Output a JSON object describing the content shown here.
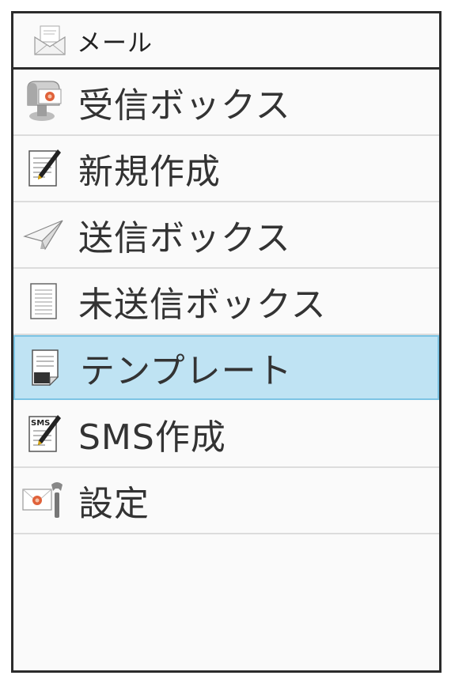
{
  "header": {
    "title": "メール",
    "icon": "mail-open-icon"
  },
  "menu": {
    "items": [
      {
        "label": "受信ボックス",
        "icon": "inbox-mailbox-icon"
      },
      {
        "label": "新規作成",
        "icon": "compose-pen-icon"
      },
      {
        "label": "送信ボックス",
        "icon": "paper-plane-icon"
      },
      {
        "label": "未送信ボックス",
        "icon": "document-icon"
      },
      {
        "label": "テンプレート",
        "icon": "template-note-icon",
        "selected": true
      },
      {
        "label": "SMS作成",
        "icon": "sms-compose-icon",
        "badge": "SMS"
      },
      {
        "label": "設定",
        "icon": "mail-wrench-icon"
      }
    ]
  },
  "colors": {
    "selected_bg": "#bfe3f3",
    "selected_border": "#7cc4e4",
    "frame": "#2b2b2b"
  }
}
